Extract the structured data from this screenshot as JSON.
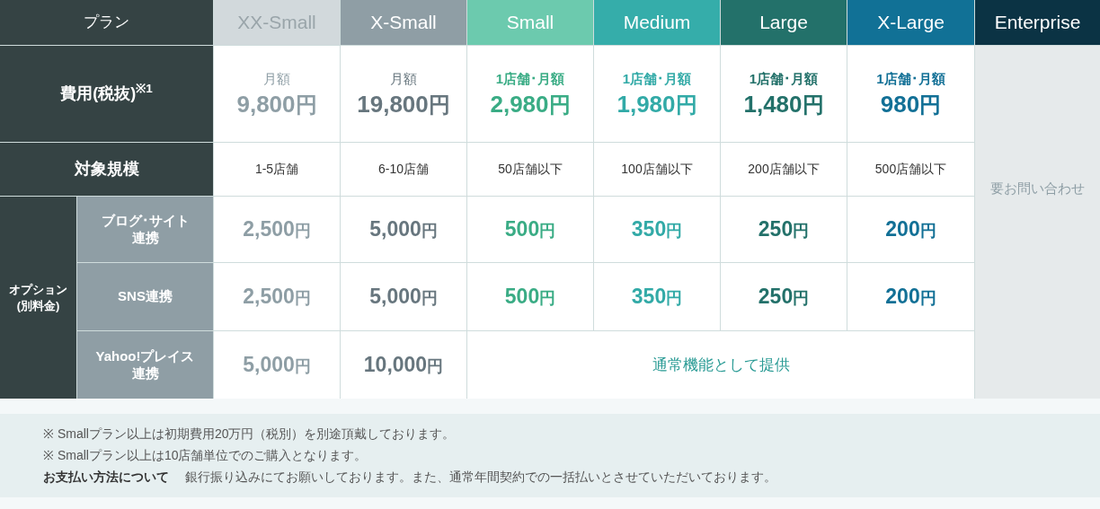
{
  "header_label": "プラン",
  "plans": [
    {
      "name": "XX-Small",
      "color": "#d2d9dc",
      "light": true
    },
    {
      "name": "X-Small",
      "color": "#8f9ea5",
      "light": false
    },
    {
      "name": "Small",
      "color": "#6ccaae",
      "light": false
    },
    {
      "name": "Medium",
      "color": "#35adaa",
      "light": false
    },
    {
      "name": "Large",
      "color": "#23716a",
      "light": false
    },
    {
      "name": "X-Large",
      "color": "#117196",
      "light": false
    },
    {
      "name": "Enterprise",
      "color": "#0b3344",
      "light": false
    }
  ],
  "fee": {
    "label": "費用(税抜)$^{※1}$",
    "cells": [
      {
        "unit": "月額",
        "amount": "9,800",
        "currency": "円",
        "color": "#8e9ea5"
      },
      {
        "unit": "月額",
        "amount": "19,800",
        "currency": "円",
        "color": "#67767e"
      },
      {
        "unit": "1店舗･月額",
        "amount": "2,980",
        "currency": "円",
        "color": "#3aac85"
      },
      {
        "unit": "1店舗･月額",
        "amount": "1,980",
        "currency": "円",
        "color": "#32aaa7"
      },
      {
        "unit": "1店舗･月額",
        "amount": "1,480",
        "currency": "円",
        "color": "#23716a"
      },
      {
        "unit": "1店舗･月額",
        "amount": "980",
        "currency": "円",
        "color": "#127096"
      }
    ]
  },
  "scale": {
    "label": "対象規模",
    "cells": [
      "1-5店舗",
      "6-10店舗",
      "50店舗以下",
      "100店舗以下",
      "200店舗以下",
      "500店舗以下"
    ]
  },
  "enterprise_note": "要お問い合わせ",
  "options": {
    "group_label": [
      "オプション",
      "(別料金)"
    ],
    "rows": [
      {
        "label": [
          "ブログ･サイト",
          "連携"
        ],
        "cells": [
          {
            "amount": "2,500",
            "currency": "円",
            "color": "#8e9ea5"
          },
          {
            "amount": "5,000",
            "currency": "円",
            "color": "#67767e"
          },
          {
            "amount": "500",
            "currency": "円",
            "color": "#3aac85"
          },
          {
            "amount": "350",
            "currency": "円",
            "color": "#32aaa7"
          },
          {
            "amount": "250",
            "currency": "円",
            "color": "#23716a"
          },
          {
            "amount": "200",
            "currency": "円",
            "color": "#127096"
          }
        ]
      },
      {
        "label": [
          "SNS連携"
        ],
        "cells": [
          {
            "amount": "2,500",
            "currency": "円",
            "color": "#8e9ea5"
          },
          {
            "amount": "5,000",
            "currency": "円",
            "color": "#67767e"
          },
          {
            "amount": "500",
            "currency": "円",
            "color": "#3aac85"
          },
          {
            "amount": "350",
            "currency": "円",
            "color": "#32aaa7"
          },
          {
            "amount": "250",
            "currency": "円",
            "color": "#23716a"
          },
          {
            "amount": "200",
            "currency": "円",
            "color": "#127096"
          }
        ]
      },
      {
        "label": [
          "Yahoo!プレイス",
          "連携"
        ],
        "cells": [
          {
            "amount": "5,000",
            "currency": "円",
            "color": "#8e9ea5"
          },
          {
            "amount": "10,000",
            "currency": "円",
            "color": "#67767e"
          }
        ],
        "included": "通常機能として提供"
      }
    ]
  },
  "notes": [
    "※ Smallプラン以上は初期費用20万円（税別）を別途頂戴しております。",
    "※ Smallプラン以上は10店舗単位でのご購入となります。"
  ],
  "payment": {
    "title": "お支払い方法について",
    "text": "銀行振り込みにてお願いしております。また、通常年間契約での一括払いとさせていただいております。"
  }
}
